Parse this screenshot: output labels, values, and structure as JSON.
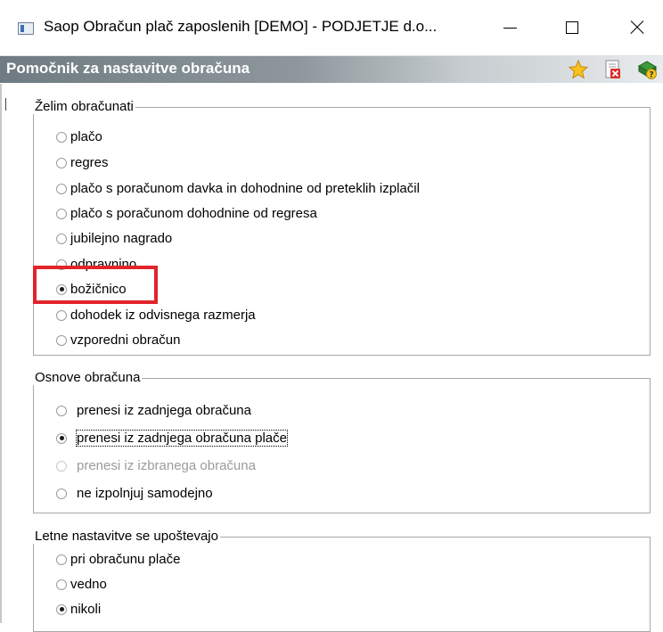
{
  "window": {
    "title": "Saop Obračun plač zaposlenih [DEMO] - PODJETJE d.o...",
    "controls": [
      "minimize",
      "maximize",
      "close"
    ]
  },
  "header": {
    "title": "Pomočnik za nastavitve obračuna",
    "icons": [
      "star-icon",
      "document-close-icon",
      "help-icon"
    ]
  },
  "groups": {
    "obracunati": {
      "legend": "Želim obračunati",
      "options": [
        {
          "label": "plačo",
          "checked": false
        },
        {
          "label": "regres",
          "checked": false
        },
        {
          "label": "plačo s poračunom davka in dohodnine od preteklih izplačil",
          "checked": false
        },
        {
          "label": "plačo s poračunom dohodnine od regresa",
          "checked": false
        },
        {
          "label": "jubilejno nagrado",
          "checked": false
        },
        {
          "label": "odpravnino",
          "checked": false
        },
        {
          "label": "božičnico",
          "checked": true
        },
        {
          "label": "dohodek iz odvisnega razmerja",
          "checked": false
        },
        {
          "label": "vzporedni obračun",
          "checked": false
        }
      ]
    },
    "osnove": {
      "legend": "Osnove obračuna",
      "options": [
        {
          "label": "prenesi iz zadnjega obračuna",
          "checked": false,
          "disabled": false
        },
        {
          "label": "prenesi iz zadnjega obračuna plače",
          "checked": true,
          "disabled": false
        },
        {
          "label": "prenesi iz izbranega obračuna",
          "checked": false,
          "disabled": true
        },
        {
          "label": "ne izpolnjuj samodejno",
          "checked": false,
          "disabled": false
        }
      ]
    },
    "letne": {
      "legend": "Letne nastavitve se upoštevajo",
      "options": [
        {
          "label": "pri obračunu plače",
          "checked": false
        },
        {
          "label": "vedno",
          "checked": false
        },
        {
          "label": "nikoli",
          "checked": true
        }
      ]
    }
  },
  "colors": {
    "highlight": "#e2242b",
    "header_text": "#ffffff",
    "disabled_text": "#9b9b9b"
  }
}
